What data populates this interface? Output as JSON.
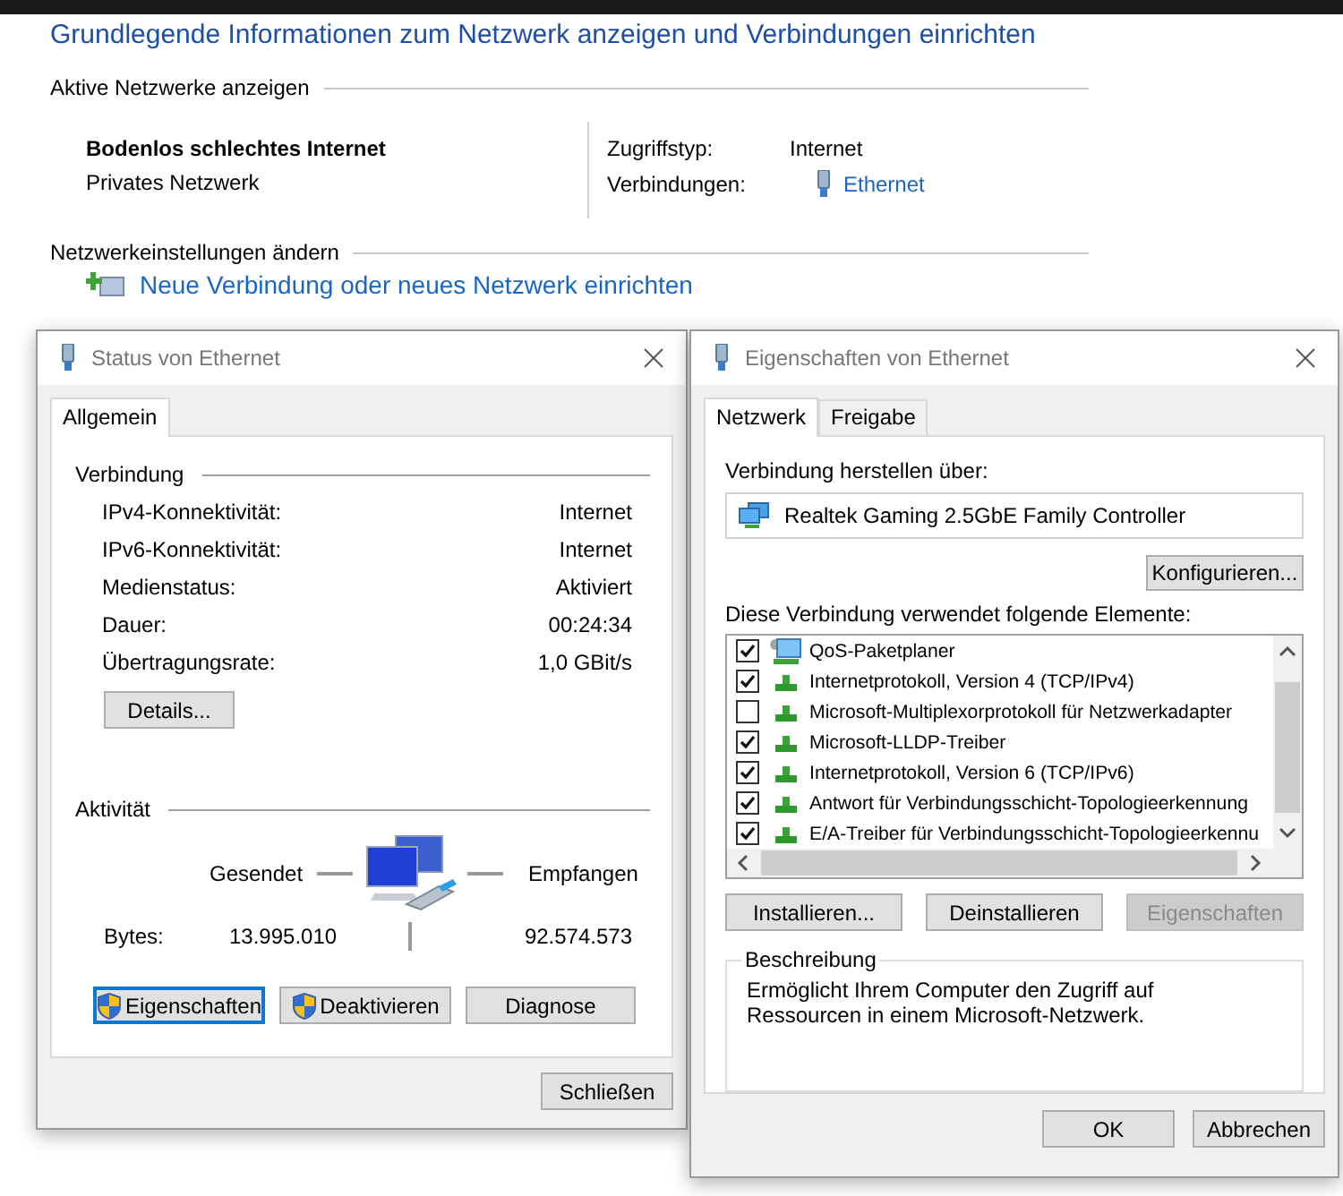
{
  "page": {
    "title": "Grundlegende Informationen zum Netzwerk anzeigen und Verbindungen einrichten",
    "active_heading": "Aktive Netzwerke anzeigen",
    "network_name": "Bodenlos schlechtes Internet",
    "network_type": "Privates Netzwerk",
    "access_label": "Zugriffstyp:",
    "access_value": "Internet",
    "connections_label": "Verbindungen:",
    "connections_link": "Ethernet",
    "settings_heading": "Netzwerkeinstellungen ändern",
    "new_connection_link": "Neue Verbindung oder neues Netzwerk einrichten"
  },
  "status_dialog": {
    "title": "Status von Ethernet",
    "tabs": [
      {
        "label": "Allgemein",
        "selected": true
      }
    ],
    "connection_heading": "Verbindung",
    "rows": [
      {
        "label": "IPv4-Konnektivität:",
        "value": "Internet"
      },
      {
        "label": "IPv6-Konnektivität:",
        "value": "Internet"
      },
      {
        "label": "Medienstatus:",
        "value": "Aktiviert"
      },
      {
        "label": "Dauer:",
        "value": "00:24:34"
      },
      {
        "label": "Übertragungsrate:",
        "value": "1,0 GBit/s"
      }
    ],
    "details_button": "Details...",
    "activity_heading": "Aktivität",
    "sent_label": "Gesendet",
    "received_label": "Empfangen",
    "bytes_label": "Bytes:",
    "bytes_sent": "13.995.010",
    "bytes_received": "92.574.573",
    "buttons": [
      {
        "label": "Eigenschaften",
        "shield": true,
        "focused": true
      },
      {
        "label": "Deaktivieren",
        "shield": true,
        "focused": false
      },
      {
        "label": "Diagnose",
        "shield": false,
        "focused": false
      }
    ],
    "close_button": "Schließen"
  },
  "properties_dialog": {
    "title": "Eigenschaften von Ethernet",
    "tabs": [
      {
        "label": "Netzwerk",
        "selected": true
      },
      {
        "label": "Freigabe",
        "selected": false
      }
    ],
    "connect_label": "Verbindung herstellen über:",
    "adapter": "Realtek Gaming 2.5GbE Family Controller",
    "configure_button": "Konfigurieren...",
    "items_label": "Diese Verbindung verwendet folgende Elemente:",
    "items": [
      {
        "label": "QoS-Paketplaner",
        "checked": true,
        "kind": "service"
      },
      {
        "label": "Internetprotokoll, Version 4 (TCP/IPv4)",
        "checked": true,
        "kind": "protocol"
      },
      {
        "label": "Microsoft-Multiplexorprotokoll für Netzwerkadapter",
        "checked": false,
        "kind": "protocol"
      },
      {
        "label": "Microsoft-LLDP-Treiber",
        "checked": true,
        "kind": "protocol"
      },
      {
        "label": "Internetprotokoll, Version 6 (TCP/IPv6)",
        "checked": true,
        "kind": "protocol"
      },
      {
        "label": "Antwort für Verbindungsschicht-Topologieerkennung",
        "checked": true,
        "kind": "protocol"
      },
      {
        "label": "E/A-Treiber für Verbindungsschicht-Topologieerkennu",
        "checked": true,
        "kind": "protocol"
      }
    ],
    "buttons": [
      {
        "label": "Installieren...",
        "disabled": false
      },
      {
        "label": "Deinstallieren",
        "disabled": false
      },
      {
        "label": "Eigenschaften",
        "disabled": true
      }
    ],
    "description_heading": "Beschreibung",
    "description": "Ermöglicht Ihrem Computer den Zugriff auf Ressourcen in einem Microsoft-Netzwerk.",
    "ok_button": "OK",
    "cancel_button": "Abbrechen"
  }
}
